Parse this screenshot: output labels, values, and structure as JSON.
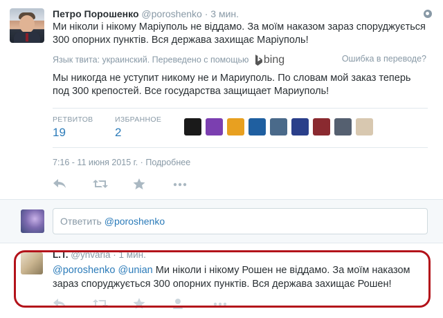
{
  "tweet": {
    "author_name": "Петро Порошенко",
    "author_handle": "@poroshenko",
    "separator": "·",
    "time_ago": "3 мин.",
    "text": "Ми ніколи і нікому Маріуполь не віддамо. За моїм наказом зараз споруджується 300 опорних пунктів. Вся держава захищає Маріуполь!",
    "translation_note": "Язык твита: украинский. Переведено с помощью",
    "translator": "bing",
    "translation_error_link": "Ошибка в переводе?",
    "translated_text": "Мы никогда не уступит никому не и Мариуполь. По словам мой заказ теперь под 300 крепостей. Все государства защищает Мариуполь!",
    "retweets_label": "РЕТВИТОВ",
    "retweets_count": "19",
    "favorites_label": "ИЗБРАННОЕ",
    "favorites_count": "2",
    "timestamp": "7:16 - 11 июня 2015 г.",
    "details_link": "Подробнее",
    "fav_avatar_colors": [
      "#1a1a1a",
      "#7b3fb0",
      "#e8a020",
      "#1f5fa0",
      "#4a6a8a",
      "#2a3f8a",
      "#8a2a30",
      "#556070",
      "#d8c8b0"
    ]
  },
  "reply_box": {
    "placeholder_prefix": "Ответить",
    "mention": "@poroshenko"
  },
  "reply": {
    "author_name": "L.T.",
    "author_handle": "@ynvaria",
    "separator": "·",
    "time_ago": "1 мин.",
    "mention1": "@poroshenko",
    "mention2": "@unian",
    "text": "Ми ніколи і нікому Рошен не віддамо. За моїм наказом зараз споруджується 300 опорних пунктів. Вся держава захищає Рошен!"
  },
  "colors": {
    "link": "#2b7bb9",
    "muted": "#8899a6",
    "highlight": "#b3121a"
  }
}
